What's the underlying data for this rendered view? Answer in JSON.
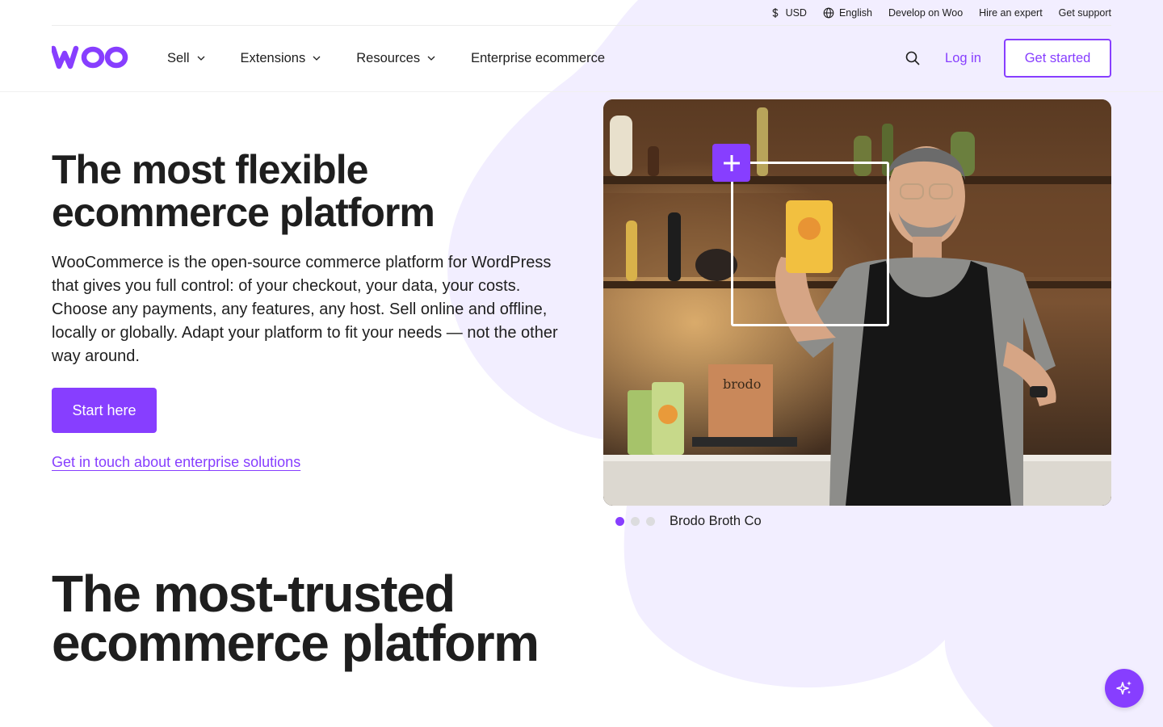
{
  "colors": {
    "accent": "#873eff",
    "blob": "#f2eeff",
    "text": "#1e1e1e"
  },
  "utility": {
    "currency": "USD",
    "language": "English",
    "develop": "Develop on Woo",
    "hire": "Hire an expert",
    "support": "Get support"
  },
  "nav": {
    "logo_alt": "woo",
    "sell": "Sell",
    "extensions": "Extensions",
    "resources": "Resources",
    "enterprise": "Enterprise ecommerce",
    "login": "Log in",
    "get_started": "Get started"
  },
  "hero": {
    "title": "The most flexible ecommerce platform",
    "description": "WooCommerce is the open-source commerce platform for WordPress that gives you full control: of your checkout, your data, your costs. Choose any payments, any features, any host. Sell online and offline, locally or globally. Adapt your platform to fit your needs — not the other way around.",
    "start_button": "Start here",
    "enterprise_link": "Get in touch about enterprise solutions"
  },
  "carousel": {
    "caption": "Brodo Broth Co",
    "dots": 3,
    "active_index": 0
  },
  "trusted": {
    "title": "The most-trusted ecommerce platform"
  }
}
